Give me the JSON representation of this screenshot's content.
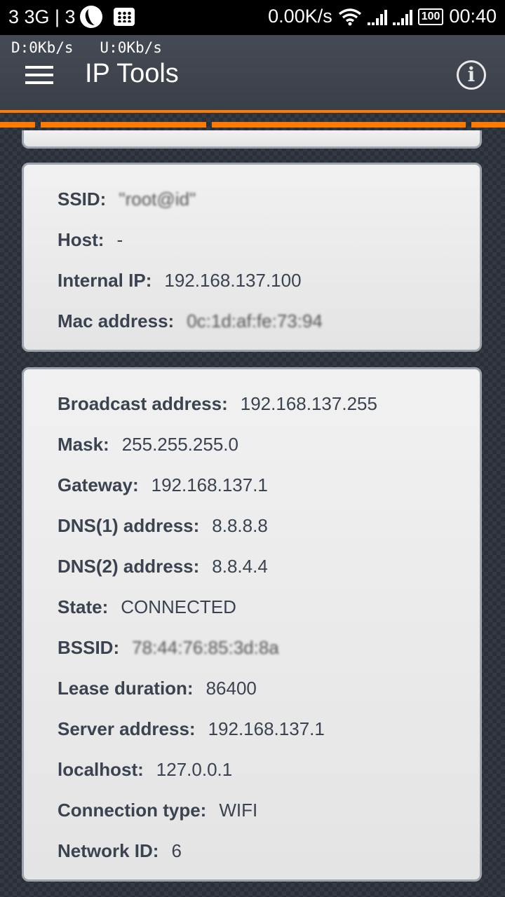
{
  "status_bar": {
    "carrier": "3 3G | 3",
    "net_speed": "0.00K/s",
    "battery": "100",
    "time": "00:40"
  },
  "app_bar": {
    "speed_line": "D:0Kb/s   U:0Kb/s",
    "title": "IP Tools"
  },
  "wifi_card": {
    "rows": [
      {
        "label": "SSID:",
        "value": "\"root@id\""
      },
      {
        "label": "Host:",
        "value": "-"
      },
      {
        "label": "Internal IP:",
        "value": "192.168.137.100"
      },
      {
        "label": "Mac address:",
        "value": "0c:1d:af:fe:73:94"
      }
    ]
  },
  "network_card": {
    "rows": [
      {
        "label": "Broadcast address:",
        "value": "192.168.137.255"
      },
      {
        "label": "Mask:",
        "value": "255.255.255.0"
      },
      {
        "label": "Gateway:",
        "value": "192.168.137.1"
      },
      {
        "label": "DNS(1) address:",
        "value": "8.8.8.8"
      },
      {
        "label": "DNS(2) address:",
        "value": "8.8.4.4"
      },
      {
        "label": "State:",
        "value": "CONNECTED"
      },
      {
        "label": "BSSID:",
        "value": "78:44:76:85:3d:8a"
      },
      {
        "label": "Lease duration:",
        "value": "86400"
      },
      {
        "label": "Server address:",
        "value": "192.168.137.1"
      },
      {
        "label": "localhost:",
        "value": "127.0.0.1"
      },
      {
        "label": "Connection type:",
        "value": "WIFI"
      },
      {
        "label": "Network ID:",
        "value": "6"
      }
    ]
  },
  "icons": {
    "menu": "hamburger-menu-icon",
    "info": "info-icon",
    "wifi": "wifi-icon",
    "signal": "signal-icon",
    "battery": "battery-icon"
  },
  "colors": {
    "accent": "#ff7a00",
    "app_bar": "#40454e",
    "card": "#ebebeb",
    "text": "#3b4250"
  }
}
